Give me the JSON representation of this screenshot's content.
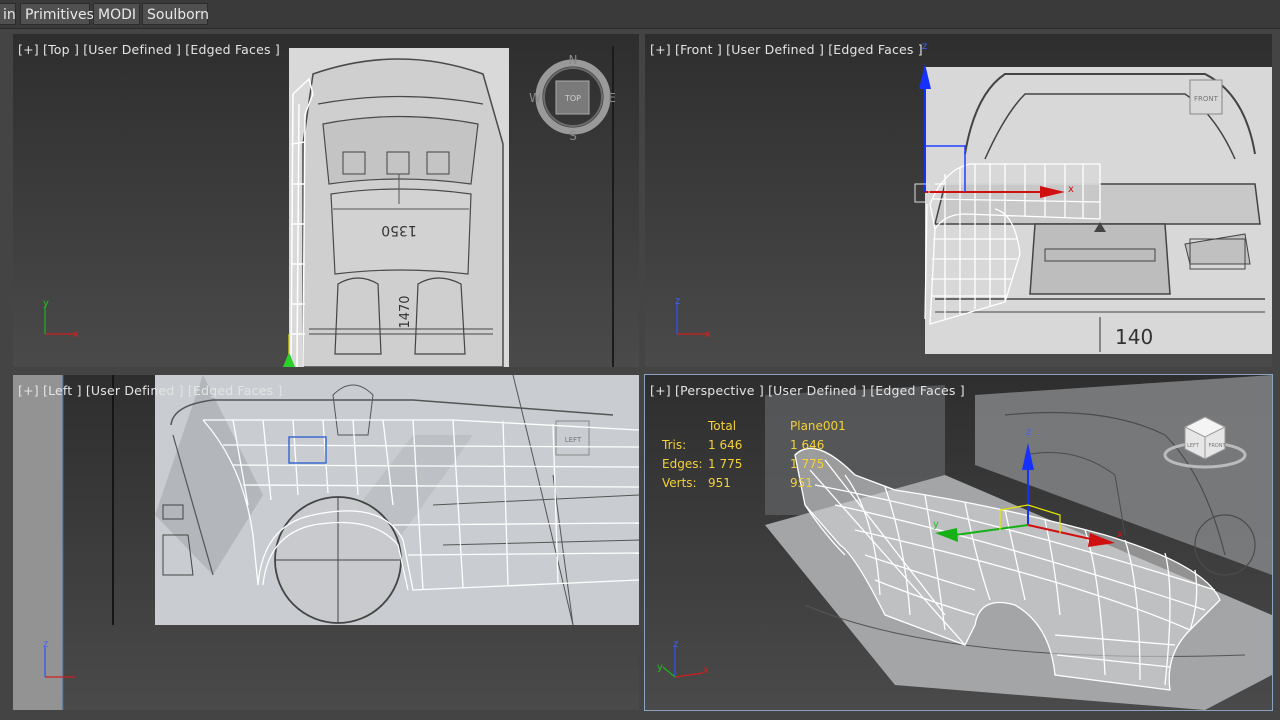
{
  "menu_tabs": [
    "in",
    "Primitives",
    "MODI",
    "Soulborn"
  ],
  "viewports": {
    "top": {
      "label": "[+] [Top ] [User Defined ] [Edged Faces ]",
      "compass": {
        "n": "N",
        "s": "S",
        "e": "E",
        "w": "W",
        "cube": "TOP"
      },
      "dim_1350": "1350",
      "dim_1470": "1470"
    },
    "front": {
      "label": "[+] [Front ] [User Defined ] [Edged Faces ]",
      "cube": "FRONT",
      "dim_140": "140"
    },
    "left": {
      "label": "[+] [Left ] [User Defined ] [Edged Faces ]",
      "cube": "LEFT"
    },
    "perspective": {
      "label": "[+] [Perspective ] [User Defined ] [Edged Faces ]",
      "cube_front": "FRONT",
      "cube_left": "LEFT"
    }
  },
  "stats": {
    "col_total": "Total",
    "col_object": "Plane001",
    "rows": [
      {
        "label": "Tris:",
        "total": "1 646",
        "object": "1 646"
      },
      {
        "label": "Edges:",
        "total": "1 775",
        "object": "1 775"
      },
      {
        "label": "Verts:",
        "total": "951",
        "object": "951"
      }
    ]
  },
  "axis_labels": {
    "x": "x",
    "y": "y",
    "z": "z"
  }
}
